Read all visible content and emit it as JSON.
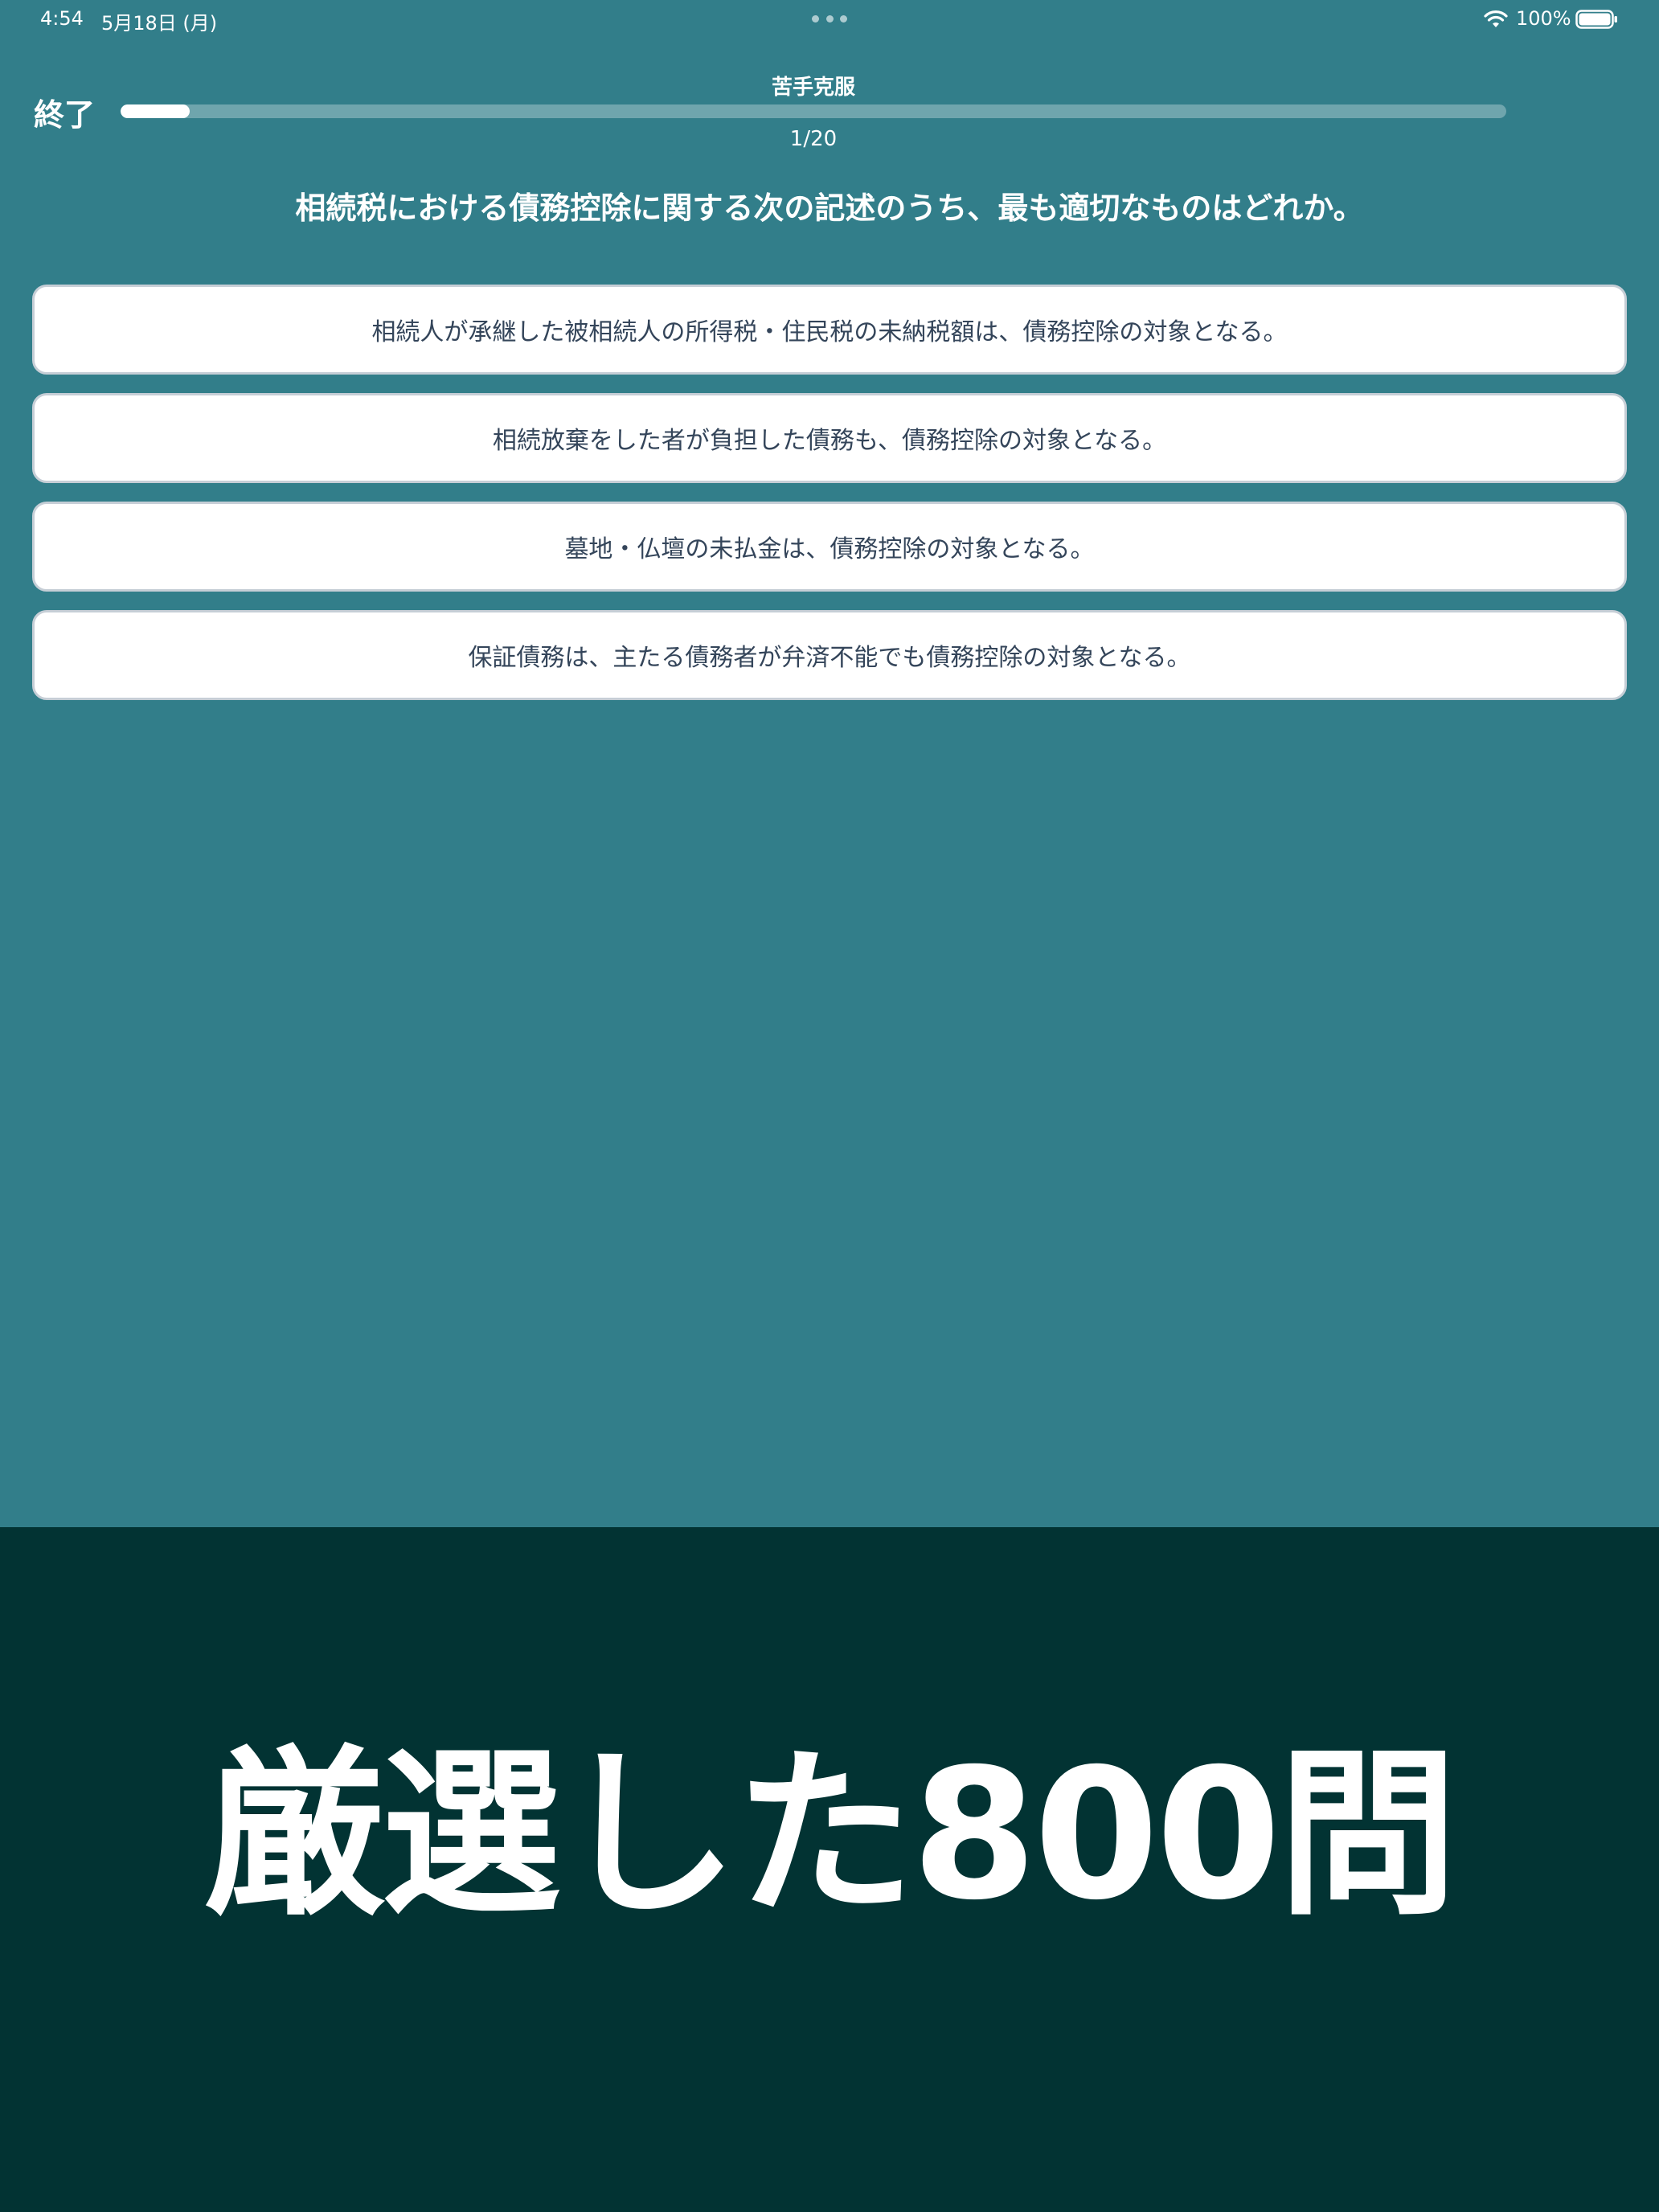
{
  "status_bar": {
    "time": "4:54",
    "date": "5月18日 (月)",
    "battery_percent": "100%",
    "battery_level": 1.0,
    "wifi_icon": "wifi-icon",
    "battery_icon": "battery-icon"
  },
  "header": {
    "end_label": "終了",
    "mode_title": "苦手克服",
    "progress_counter": "1/20",
    "progress_fraction": 0.05
  },
  "question": {
    "text": "相続税における債務控除に関する次の記述のうち、最も適切なものはどれか。"
  },
  "answers": [
    {
      "label": "相続人が承継した被相続人の所得税・住民税の未納税額は、債務控除の対象となる。"
    },
    {
      "label": "相続放棄をした者が負担した債務も、債務控除の対象となる。"
    },
    {
      "label": "墓地・仏壇の未払金は、債務控除の対象となる。"
    },
    {
      "label": "保証債務は、主たる債務者が弁済不能でも債務控除の対象となる。"
    }
  ],
  "promo": {
    "text": "厳選した800問"
  },
  "colors": {
    "app_background": "#327e8a",
    "banner_background": "#023333",
    "answer_text": "#34455a",
    "answer_border": "#c6ced6"
  }
}
